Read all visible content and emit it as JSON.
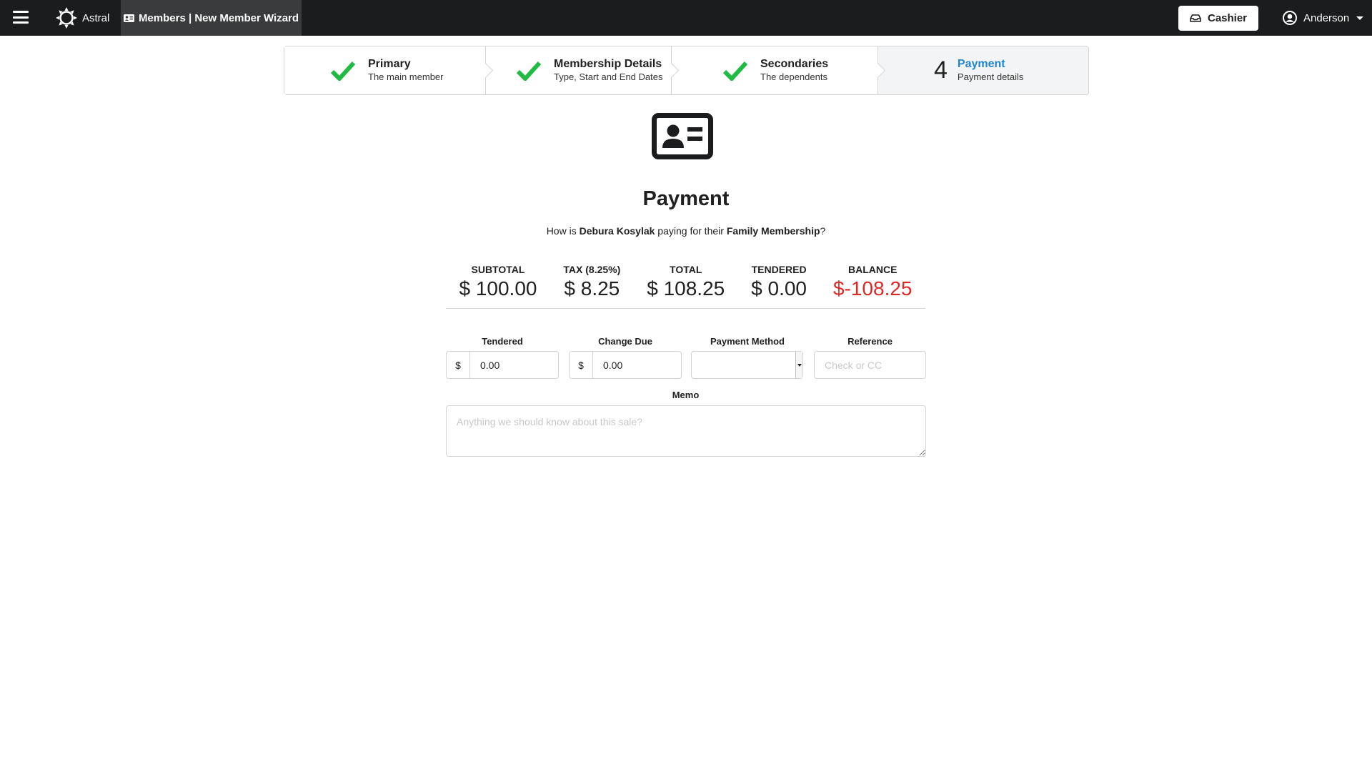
{
  "topbar": {
    "app_name": "Astral",
    "active_tab": "Members | New Member Wizard",
    "cashier_label": "Cashier",
    "user_name": "Anderson"
  },
  "steps": [
    {
      "title": "Primary",
      "description": "The main member",
      "state": "complete",
      "icon": "checkmark-icon"
    },
    {
      "title": "Membership Details",
      "description": "Type, Start and End Dates",
      "state": "complete",
      "icon": "checkmark-icon"
    },
    {
      "title": "Secondaries",
      "description": "The dependents",
      "state": "complete",
      "icon": "checkmark-icon"
    },
    {
      "number": "4",
      "title": "Payment",
      "description": "Payment details",
      "state": "active"
    }
  ],
  "page": {
    "icon": "id-card-icon",
    "title": "Payment",
    "question_prefix": "How is ",
    "member_name": "Debura Kosylak",
    "question_middle": " paying for their ",
    "membership_type": "Family Membership",
    "question_suffix": "?"
  },
  "totals": {
    "subtotal_label": "SUBTOTAL",
    "subtotal": "$ 100.00",
    "tax_label": "TAX (8.25%)",
    "tax": "$ 8.25",
    "total_label": "TOTAL",
    "total": "$ 108.25",
    "tendered_label": "TENDERED",
    "tendered": "$ 0.00",
    "balance_label": "BALANCE",
    "balance": "$-108.25"
  },
  "form": {
    "tendered_label": "Tendered",
    "tendered_prefix": "$",
    "tendered_value": "0.00",
    "change_due_label": "Change Due",
    "change_due_prefix": "$",
    "change_due_value": "0.00",
    "payment_method_label": "Payment Method",
    "payment_method_value": "",
    "reference_label": "Reference",
    "reference_placeholder": "Check or CC",
    "memo_label": "Memo",
    "memo_placeholder": "Anything we should know about this sale?"
  },
  "colors": {
    "topbar": "#1b1c1d",
    "active_tab": "#3a3b3c",
    "check": "#21ba45",
    "active_step": "#2185d0",
    "negative_balance": "#db2828"
  }
}
